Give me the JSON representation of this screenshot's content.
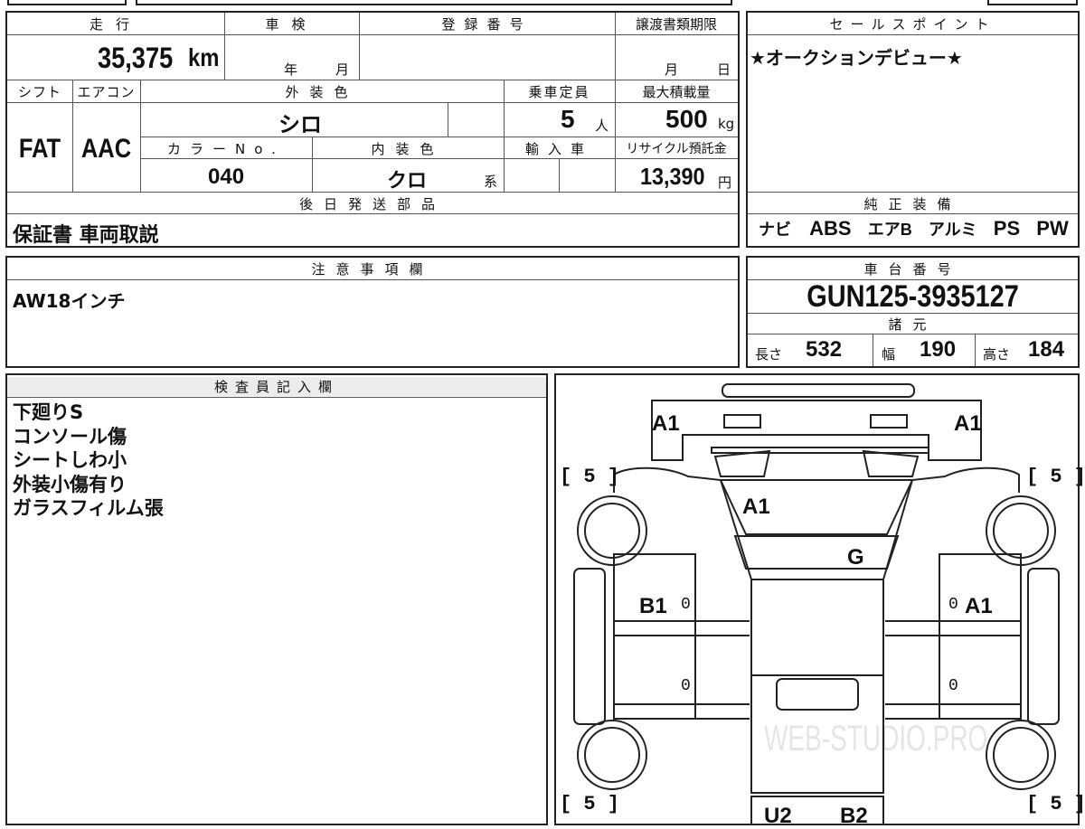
{
  "mileage": {
    "label": "走行",
    "value": "35,375",
    "unit": "km"
  },
  "inspection": {
    "label": "車検",
    "year_unit": "年",
    "month_unit": "月"
  },
  "registration": {
    "label": "登録番号",
    "value": ""
  },
  "transfer_deadline": {
    "label": "譲渡書類期限",
    "month_unit": "月",
    "day_unit": "日"
  },
  "sales_point": {
    "label": "セールスポイント",
    "text": "★オークションデビュー★"
  },
  "shift": {
    "label": "シフト",
    "value": "FAT"
  },
  "aircon": {
    "label": "エアコン",
    "value": "AAC"
  },
  "exterior_color": {
    "label": "外装色",
    "value": "シロ"
  },
  "capacity": {
    "label": "乗車定員",
    "value": "5",
    "unit": "人"
  },
  "max_load": {
    "label": "最大積載量",
    "value": "500",
    "unit": "kg"
  },
  "color_no": {
    "label": "カラーNo.",
    "value": "040"
  },
  "interior_color": {
    "label": "内装色",
    "value": "クロ",
    "suffix": "系"
  },
  "import": {
    "label": "輸入車"
  },
  "recycle": {
    "label": "リサイクル預託金",
    "value": "13,390",
    "unit": "円"
  },
  "later_parts": {
    "label": "後日発送部品",
    "text": "保証書 車両取説"
  },
  "equipment": {
    "label": "純正装備",
    "items": [
      "ナビ",
      "ABS",
      "エアB",
      "アルミ",
      "PS",
      "PW"
    ]
  },
  "notes": {
    "label": "注意事項欄",
    "text": "AW18インチ"
  },
  "chassis": {
    "label": "車台番号",
    "value": "GUN125-3935127"
  },
  "specs": {
    "label": "諸元",
    "length_label": "長さ",
    "length": "532",
    "width_label": "幅",
    "width": "190",
    "height_label": "高さ",
    "height": "184"
  },
  "inspector": {
    "label": "検査員記入欄",
    "lines": [
      "下廻りS",
      "コンソール傷",
      "シートしわ小",
      "外装小傷有り",
      "ガラスフィルム張"
    ]
  },
  "diagram": {
    "marks": {
      "rear_left": "A1",
      "rear_right": "A1",
      "hood": "A1",
      "windshield": "G",
      "left_door": "B1",
      "right_door": "A1",
      "rear_bottom_l": "U2",
      "rear_bottom_r": "B2"
    },
    "tires": {
      "fl": "5",
      "fr": "5",
      "rl": "5",
      "rr": "5"
    },
    "zeros": [
      "0",
      "0",
      "0",
      "0"
    ]
  },
  "watermark": "WEB-STUDIO.PRO"
}
